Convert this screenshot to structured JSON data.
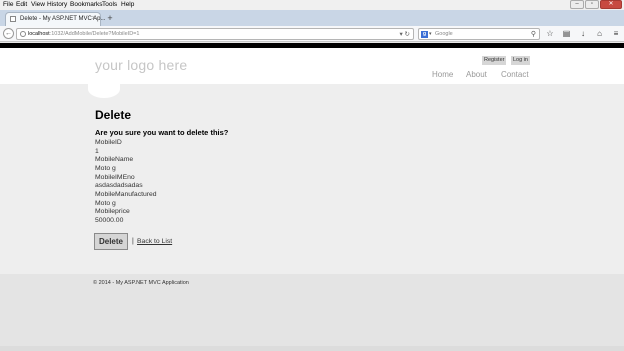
{
  "browser": {
    "menu": [
      "File",
      "Edit",
      "View",
      "History",
      "Bookmarks",
      "Tools",
      "Help"
    ],
    "window_controls": [
      "–",
      "▫",
      "✕"
    ],
    "tab_title": "Delete - My ASP.NET MVC Ap...",
    "tab_close": "×",
    "newtab": "+",
    "url_host": "localhost",
    "url_rest": ":1032/AddMobile/Delete?MobileID=1",
    "search_engine_letter": "g",
    "search_placeholder": "Google",
    "toolbar_icons": [
      "star-icon",
      "clipboard-icon",
      "download-icon",
      "home-icon",
      "menu-icon"
    ]
  },
  "site": {
    "logo": "your logo here",
    "login_links": [
      "Register",
      "Log in"
    ],
    "nav": [
      "Home",
      "About",
      "Contact"
    ]
  },
  "page": {
    "title": "Delete",
    "question": "Are you sure you want to delete this?",
    "fields": [
      {
        "label": "MobileID",
        "value": "1"
      },
      {
        "label": "MobileName",
        "value": "Moto g"
      },
      {
        "label": "MobileIMEno",
        "value": "asdasdadsadas"
      },
      {
        "label": "MobileManufactured",
        "value": "Moto g"
      },
      {
        "label": "Mobileprice",
        "value": "50000.00"
      }
    ],
    "delete_button": "Delete",
    "separator": "|",
    "back_link": "Back to List"
  },
  "footer": {
    "text": "© 2014 - My ASP.NET MVC Application"
  },
  "colors": {
    "main_bg": "#eeeeee",
    "footer_bg": "#e4e4e4",
    "nav_link": "#999999",
    "logo": "#c6c6c6"
  }
}
